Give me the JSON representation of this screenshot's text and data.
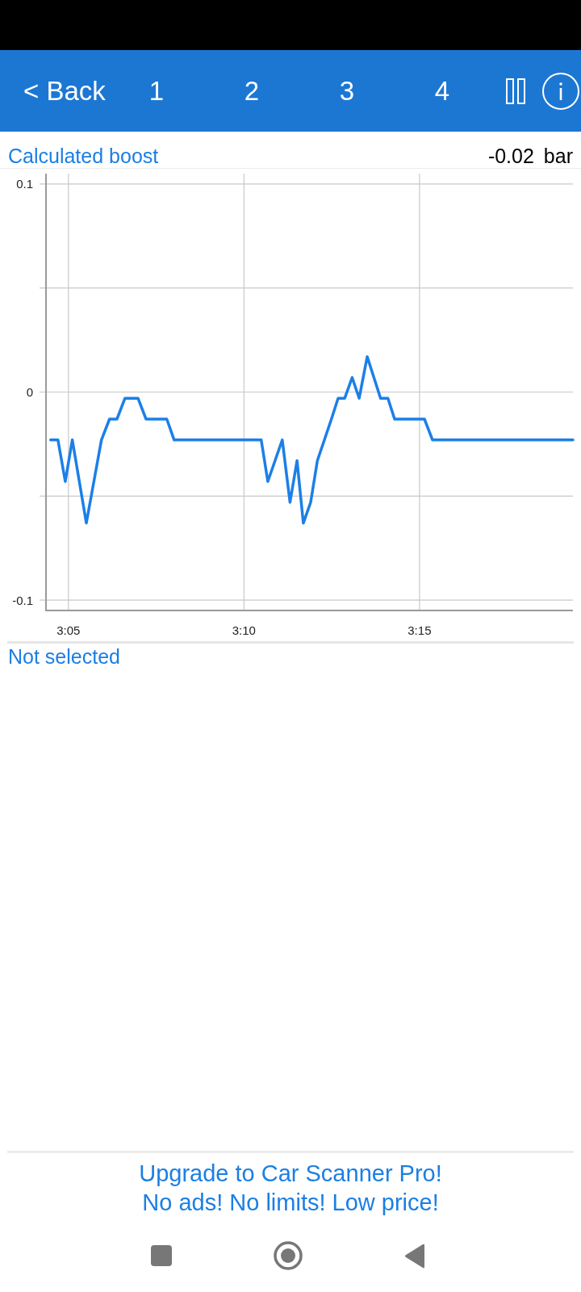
{
  "toolbar": {
    "back": "< Back",
    "tabs": [
      "1",
      "2",
      "3",
      "4"
    ]
  },
  "gauge": {
    "reading": "-0.02",
    "unit": "bar",
    "chart_data": {
      "type": "line",
      "title": "Calculated boost",
      "grid": true,
      "x": [
        184.49,
        184.7,
        184.91,
        185.11,
        185.51,
        185.94,
        186.17,
        186.38,
        186.61,
        186.98,
        187.21,
        187.8,
        188.01,
        190.49,
        190.68,
        191.09,
        191.31,
        191.51,
        191.69,
        191.9,
        192.09,
        192.49,
        192.68,
        192.87,
        193.08,
        193.28,
        193.51,
        193.89,
        194.1,
        194.29,
        195.14,
        195.37,
        199.37
      ],
      "series": [
        {
          "color": "#1c7fe8",
          "values": [
            -0.023,
            -0.023,
            -0.043,
            -0.023,
            -0.063,
            -0.023,
            -0.013,
            -0.013,
            -0.003,
            -0.003,
            -0.013,
            -0.013,
            -0.023,
            -0.023,
            -0.043,
            -0.023,
            -0.053,
            -0.033,
            -0.063,
            -0.053,
            -0.033,
            -0.013,
            -0.003,
            -0.003,
            0.007,
            -0.003,
            0.017,
            -0.003,
            -0.003,
            -0.013,
            -0.013,
            -0.023,
            -0.023
          ]
        }
      ],
      "xlim": [
        184.36,
        199.37
      ],
      "ylim": [
        -0.105,
        0.105
      ],
      "xticks": [
        {
          "value": 185,
          "label": "3:05"
        },
        {
          "value": 190,
          "label": "3:10"
        },
        {
          "value": 195,
          "label": "3:15"
        }
      ],
      "yticks": [
        -0.1,
        0,
        0.1
      ]
    }
  },
  "second_gauge": {
    "label": "Not selected"
  },
  "promo": {
    "lines": [
      "Upgrade to Car Scanner Pro!",
      "No ads! No limits! Low price!"
    ]
  }
}
